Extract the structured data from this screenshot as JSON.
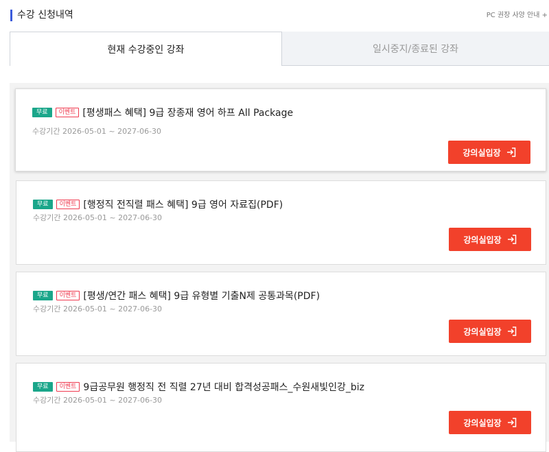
{
  "header": {
    "title": "수강 신청내역",
    "pc_link": "PC 권장 사양 안내 +"
  },
  "tabs": [
    {
      "label": "현재 수강중인 강좌",
      "active": true
    },
    {
      "label": "일시중지/종료된 강좌",
      "active": false
    }
  ],
  "courses": [
    {
      "badge_free": "무료",
      "badge_event": "이벤트",
      "title": "[평생패스 혜택] 9급 장종재 영어 하프 All Package",
      "period": "수강기간 2026-05-01 ~ 2027-06-30",
      "button": "강의실입장"
    },
    {
      "badge_free": "무료",
      "badge_event": "이벤트",
      "title": "[행정직 전직렬 패스 혜택] 9급 영어 자료집(PDF)",
      "period": "수강기간 2026-05-01 ~ 2027-06-30",
      "button": "강의실입장"
    },
    {
      "badge_free": "무료",
      "badge_event": "이벤트",
      "title": "[평생/연간 패스 혜택] 9급 유형별 기출N제 공통과목(PDF)",
      "period": "수강기간 2026-05-01 ~ 2027-06-30",
      "button": "강의실입장"
    },
    {
      "badge_free": "무료",
      "badge_event": "이벤트",
      "title": "9급공무원 행정직 전 직렬 27년 대비 합격성공패스_수원새빛인강_biz",
      "period": "수강기간 2026-05-01 ~ 2027-06-30",
      "button": "강의실입장"
    }
  ],
  "icons": {
    "enter": "enter-icon"
  },
  "colors": {
    "accent": "#f2412b",
    "free_badge": "#1aa68a",
    "event_badge": "#ef3a4f",
    "title_bar": "#3b5bdb"
  }
}
